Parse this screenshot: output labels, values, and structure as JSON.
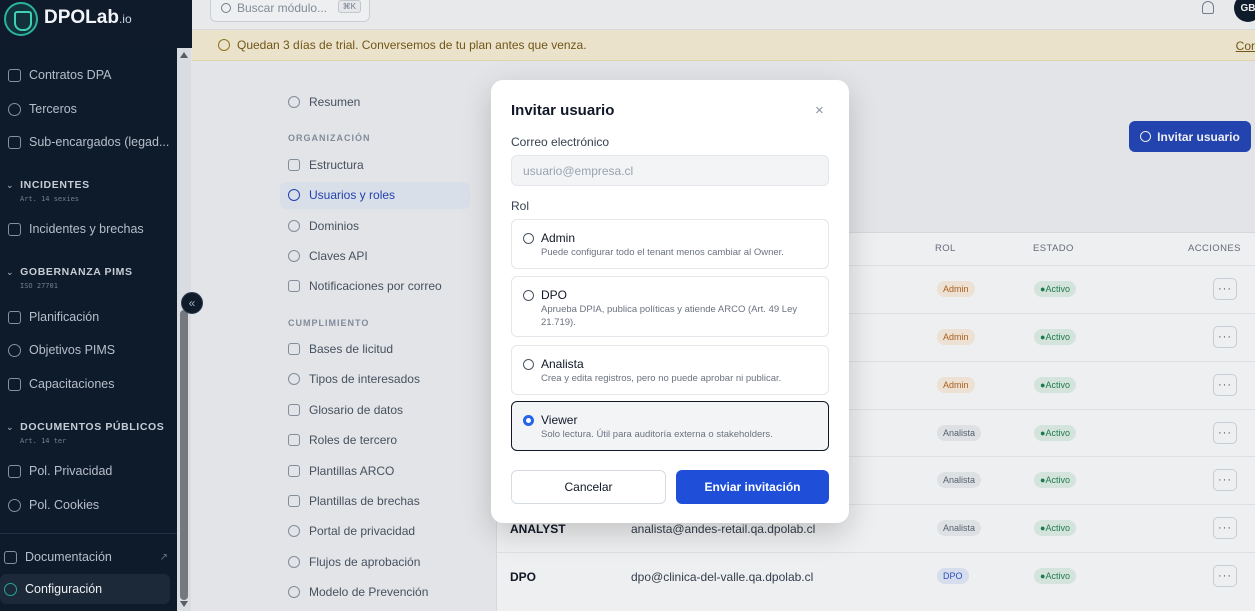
{
  "brand": {
    "name": "DPOLab",
    "suffix": ".io"
  },
  "topbar": {
    "search_placeholder": "Buscar módulo...",
    "search_shortcut": "⌘K",
    "avatar_initials": "GB"
  },
  "banner": {
    "text": "Quedan 3 días de trial. Conversemos de tu plan antes que venza.",
    "link": "Cor"
  },
  "sidebar": {
    "items_top": [
      {
        "label": "Contratos DPA",
        "icon": "file-edit-icon"
      },
      {
        "label": "Terceros",
        "icon": "users-icon"
      },
      {
        "label": "Sub-encargados (legad...",
        "icon": "network-icon"
      }
    ],
    "sections": [
      {
        "title": "INCIDENTES",
        "sub": "Art. 14 sexies",
        "items": [
          {
            "label": "Incidentes y brechas",
            "icon": "warning-icon"
          }
        ]
      },
      {
        "title": "GOBERNANZA PIMS",
        "sub": "ISO 27701",
        "items": [
          {
            "label": "Planificación",
            "icon": "calendar-icon"
          },
          {
            "label": "Objetivos PIMS",
            "icon": "target-icon"
          },
          {
            "label": "Capacitaciones",
            "icon": "graduation-icon"
          }
        ]
      },
      {
        "title": "DOCUMENTOS PÚBLICOS",
        "sub": "Art. 14 ter",
        "items": [
          {
            "label": "Pol. Privacidad",
            "icon": "document-icon"
          },
          {
            "label": "Pol. Cookies",
            "icon": "cookie-icon"
          }
        ]
      }
    ],
    "bottom": [
      {
        "label": "Documentación",
        "icon": "book-icon"
      },
      {
        "label": "Configuración",
        "icon": "gear-icon"
      }
    ],
    "collapse_glyph": "«"
  },
  "settings_nav": {
    "summary": "Resumen",
    "org_heading": "ORGANIZACIÓN",
    "org_items": [
      "Estructura",
      "Usuarios y roles",
      "Dominios",
      "Claves API",
      "Notificaciones por correo"
    ],
    "compliance_heading": "CUMPLIMIENTO",
    "compliance_items": [
      "Bases de licitud",
      "Tipos de interesados",
      "Glosario de datos",
      "Roles de tercero",
      "Plantillas ARCO",
      "Plantillas de brechas",
      "Portal de privacidad",
      "Flujos de aprobación",
      "Modelo de Prevención"
    ]
  },
  "main": {
    "invite_button": "Invitar usuario",
    "columns": {
      "rol": "ROL",
      "estado": "ESTADO",
      "acciones": "ACCIONES"
    },
    "rows": [
      {
        "role": "Admin",
        "status": "Activo"
      },
      {
        "role": "Admin",
        "status": "Activo"
      },
      {
        "role": "Admin",
        "status": "Activo"
      },
      {
        "role": "Analista",
        "status": "Activo"
      },
      {
        "role": "Analista",
        "status": "Activo"
      },
      {
        "name": "ANALYST",
        "email": "analista@andes-retail.qa.dpolab.cl",
        "role": "Analista",
        "status": "Activo"
      },
      {
        "name": "DPO",
        "email": "dpo@clinica-del-valle.qa.dpolab.cl",
        "role": "DPO",
        "status": "Activo"
      }
    ],
    "actions_glyph": "···"
  },
  "modal": {
    "title": "Invitar usuario",
    "close_glyph": "×",
    "email_label": "Correo electrónico",
    "email_placeholder": "usuario@empresa.cl",
    "email_value": "",
    "role_label": "Rol",
    "roles": [
      {
        "name": "Admin",
        "desc": "Puede configurar todo el tenant menos cambiar al Owner.",
        "selected": false
      },
      {
        "name": "DPO",
        "desc": "Aprueba DPIA, publica políticas y atiende ARCO (Art. 49 Ley 21.719).",
        "selected": false
      },
      {
        "name": "Analista",
        "desc": "Crea y edita registros, pero no puede aprobar ni publicar.",
        "selected": false
      },
      {
        "name": "Viewer",
        "desc": "Solo lectura. Útil para auditoría externa o stakeholders.",
        "selected": true
      }
    ],
    "cancel_label": "Cancelar",
    "submit_label": "Enviar invitación"
  },
  "colors": {
    "sidebar_bg": "#0f1b2a",
    "accent": "#1f4fd8",
    "banner_bg": "#fbf2d8",
    "active_status": "#22834f"
  }
}
